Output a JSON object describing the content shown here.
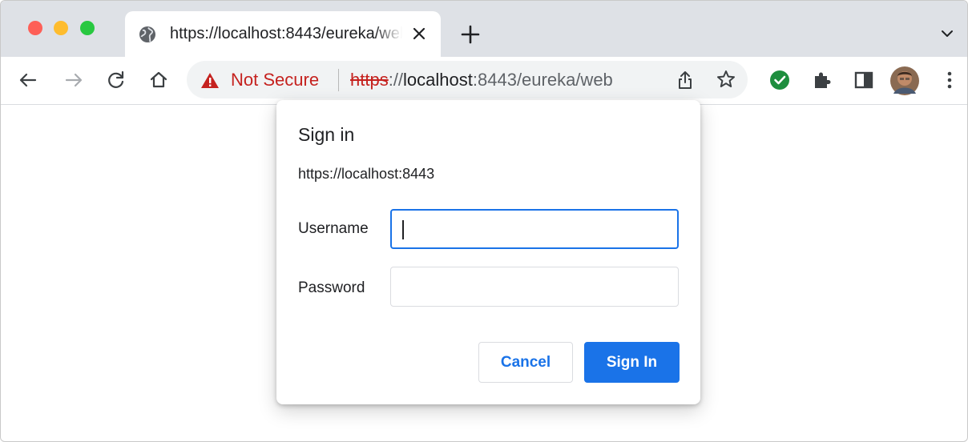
{
  "browser": {
    "tab": {
      "title": "https://localhost:8443/eureka/web",
      "favicon": "globe-icon",
      "close_icon": "close-icon"
    },
    "new_tab_icon": "plus-icon",
    "tab_menu_icon": "chevron-down-icon",
    "toolbar": {
      "nav_icons": [
        "back-arrow-icon",
        "forward-arrow-icon",
        "reload-icon",
        "home-icon"
      ],
      "security_warning": "Not Secure",
      "url": {
        "scheme": "https",
        "after_scheme": "://",
        "host": "localhost",
        "rest": ":8443/eureka/web"
      },
      "right_icons": [
        "share-icon",
        "bookmark-star-icon",
        "extension-check-icon",
        "extensions-puzzle-icon",
        "side-panel-icon",
        "profile-avatar",
        "kebab-menu-icon"
      ]
    }
  },
  "dialog": {
    "title": "Sign in",
    "origin": "https://localhost:8443",
    "username_label": "Username",
    "username_value": "",
    "password_label": "Password",
    "password_value": "",
    "cancel_label": "Cancel",
    "signin_label": "Sign In"
  },
  "colors": {
    "accent": "#1a73e8",
    "warning": "#c5221f",
    "tabstrip": "#dee1e6",
    "extension_check": "#1e8e3e"
  }
}
